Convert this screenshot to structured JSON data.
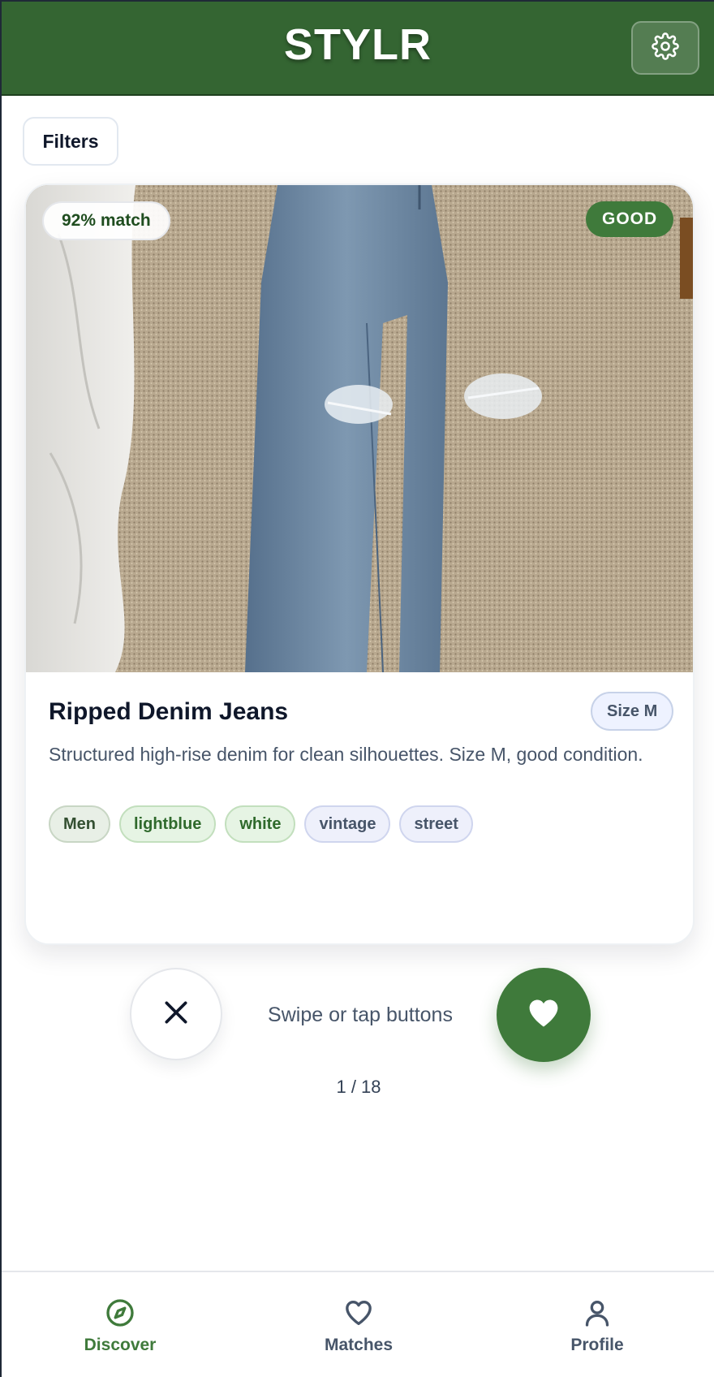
{
  "app": {
    "title": "STYLR"
  },
  "header": {
    "settings_icon": "gear-icon"
  },
  "filters": {
    "label": "Filters"
  },
  "card": {
    "match_label": "92% match",
    "condition": "GOOD",
    "title": "Ripped Denim Jeans",
    "size": "Size M",
    "description": "Structured high-rise denim for clean silhouettes. Size M, good condition.",
    "tags": [
      {
        "label": "Men",
        "kind": "gender"
      },
      {
        "label": "lightblue",
        "kind": "color"
      },
      {
        "label": "white",
        "kind": "color"
      },
      {
        "label": "vintage",
        "kind": "style"
      },
      {
        "label": "street",
        "kind": "style"
      }
    ]
  },
  "actions": {
    "dislike_icon": "close-icon",
    "hint": "Swipe or tap buttons",
    "like_icon": "heart-icon",
    "counter": "1 / 18"
  },
  "nav": {
    "items": [
      {
        "label": "Discover",
        "icon": "compass-icon",
        "active": true
      },
      {
        "label": "Matches",
        "icon": "heart-outline-icon",
        "active": false
      },
      {
        "label": "Profile",
        "icon": "user-icon",
        "active": false
      }
    ]
  },
  "colors": {
    "brand_green": "#346532",
    "accent_green": "#3f7a3b",
    "text_dark": "#0f172a",
    "text_muted": "#475569"
  }
}
